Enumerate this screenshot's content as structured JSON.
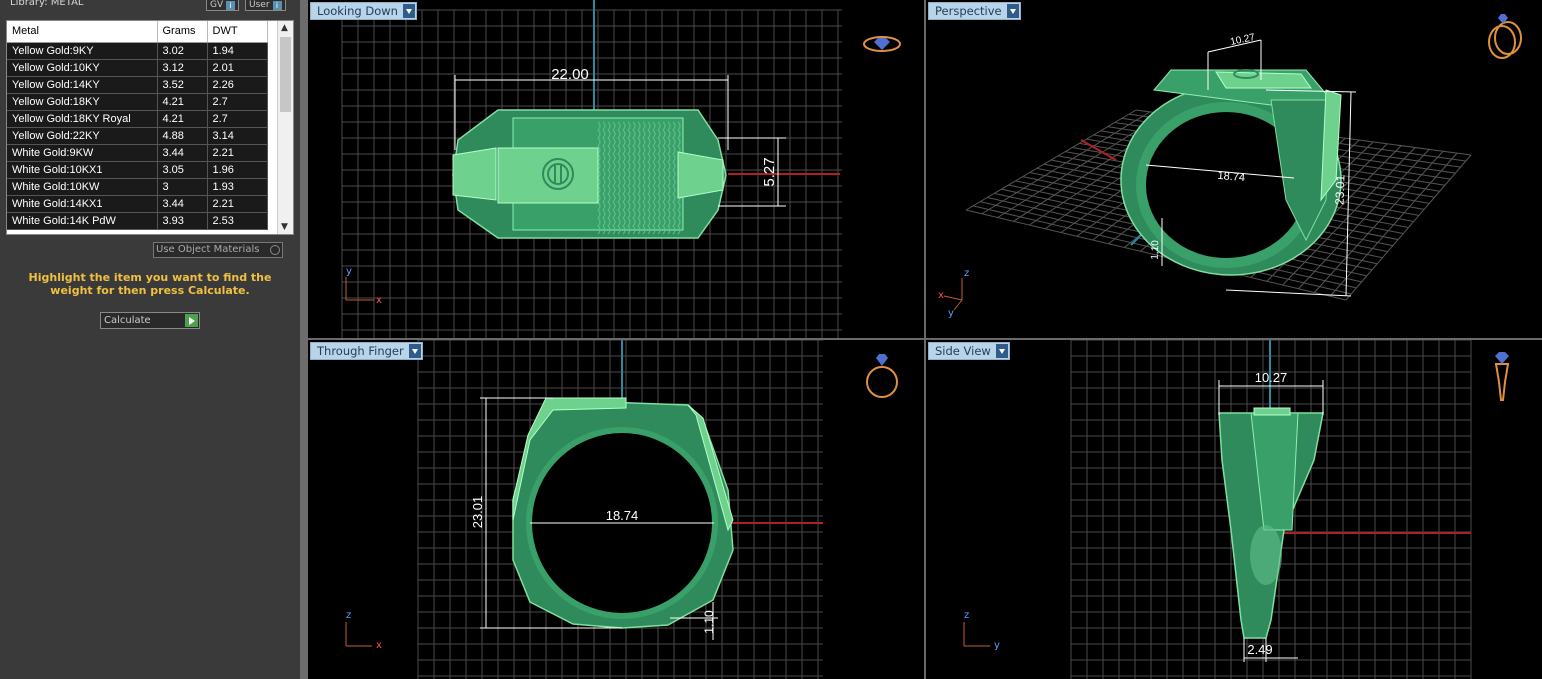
{
  "library": {
    "title": "Library: METAL",
    "gv_label": "GV",
    "user_label": "User",
    "info_icon": "info-icon"
  },
  "metal_table": {
    "headers": [
      "Metal",
      "Grams",
      "DWT"
    ],
    "rows": [
      [
        "Yellow Gold:9KY",
        "3.02",
        "1.94"
      ],
      [
        "Yellow Gold:10KY",
        "3.12",
        "2.01"
      ],
      [
        "Yellow Gold:14KY",
        "3.52",
        "2.26"
      ],
      [
        "Yellow Gold:18KY",
        "4.21",
        "2.7"
      ],
      [
        "Yellow Gold:18KY Royal",
        "4.21",
        "2.7"
      ],
      [
        "Yellow Gold:22KY",
        "4.88",
        "3.14"
      ],
      [
        "White Gold:9KW",
        "3.44",
        "2.21"
      ],
      [
        "White Gold:10KX1",
        "3.05",
        "1.96"
      ],
      [
        "White Gold:10KW",
        "3",
        "1.93"
      ],
      [
        "White Gold:14KX1",
        "3.44",
        "2.21"
      ],
      [
        "White Gold:14K PdW",
        "3.93",
        "2.53"
      ]
    ]
  },
  "controls": {
    "use_object_materials": "Use Object Materials",
    "hint": "Highlight the item you want to find the weight for then press Calculate.",
    "calculate_label": "Calculate"
  },
  "viewports": {
    "looking_down": {
      "label": "Looking Down",
      "width_dim": "22.00",
      "height_dim": "5.27",
      "axis_y": "y",
      "axis_x": "x"
    },
    "perspective": {
      "label": "Perspective",
      "top_dim": "10.27",
      "inner_dim": "18.74",
      "height_dim": "23.01",
      "base_dim": "1.10",
      "axis_z": "z",
      "axis_x": "x",
      "axis_y": "y"
    },
    "through_finger": {
      "label": "Through Finger",
      "inner_dim": "18.74",
      "height_dim": "23.01",
      "shank_dim": "1.10",
      "axis_z": "z",
      "axis_x": "x"
    },
    "side_view": {
      "label": "Side View",
      "top_dim": "10.27",
      "bottom_dim": "2.49",
      "axis_z": "z",
      "axis_y": "y"
    }
  },
  "colors": {
    "ring_body": "#2f8a5c",
    "ring_light": "#6fd18e",
    "grid": "#4a4a4a",
    "tab_bg": "#b9d4e6",
    "hint": "#f0c040"
  }
}
